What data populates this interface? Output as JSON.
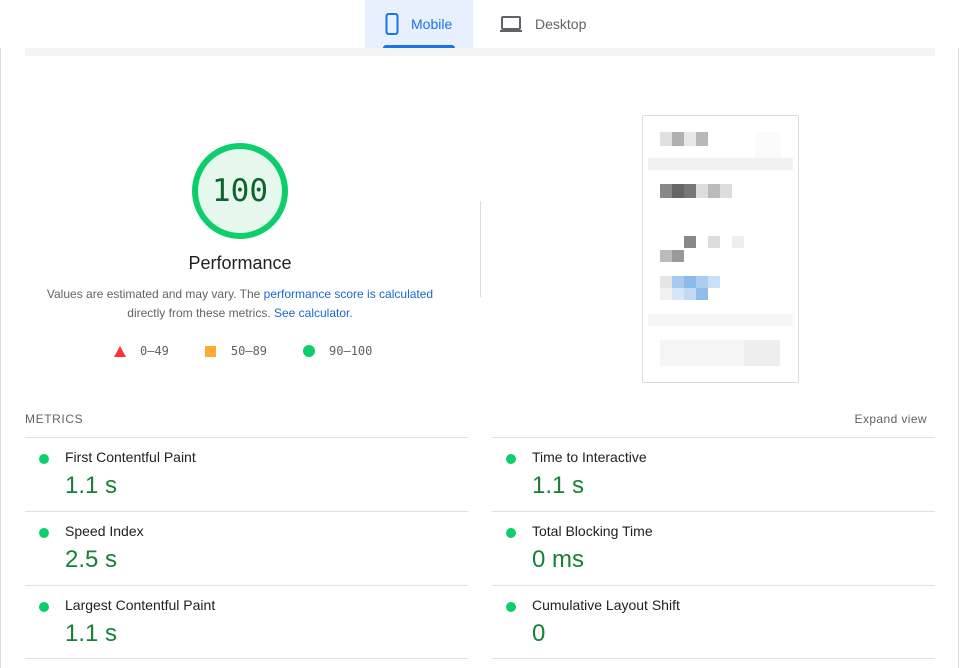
{
  "tabs": [
    {
      "label": "Mobile",
      "icon": "smartphone-icon",
      "active": true
    },
    {
      "label": "Desktop",
      "icon": "laptop-icon",
      "active": false
    }
  ],
  "performance": {
    "score": "100",
    "title": "Performance",
    "desc_prefix": "Values are estimated and may vary. The ",
    "desc_link1": "performance score is calculated",
    "desc_middle": " directly from these metrics. ",
    "desc_link2": "See calculator.",
    "color_good": "#0cce6b",
    "color_average": "#ffa400",
    "color_poor": "#ff4e42"
  },
  "legend": [
    {
      "range": "0–49",
      "shape": "triangle-icon"
    },
    {
      "range": "50–89",
      "shape": "square-icon"
    },
    {
      "range": "90–100",
      "shape": "circle-icon"
    }
  ],
  "metrics": {
    "heading": "METRICS",
    "expand_label": "Expand view",
    "items": [
      {
        "name": "First Contentful Paint",
        "value": "1.1 s"
      },
      {
        "name": "Time to Interactive",
        "value": "1.1 s"
      },
      {
        "name": "Speed Index",
        "value": "2.5 s"
      },
      {
        "name": "Total Blocking Time",
        "value": "0 ms"
      },
      {
        "name": "Largest Contentful Paint",
        "value": "1.1 s"
      },
      {
        "name": "Cumulative Layout Shift",
        "value": "0"
      }
    ]
  }
}
